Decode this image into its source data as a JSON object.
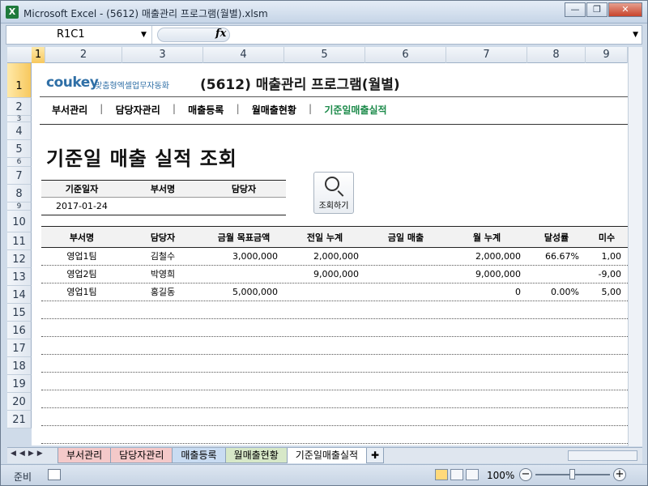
{
  "window": {
    "title": "Microsoft Excel - (5612) 매출관리 프로그램(월별).xlsm"
  },
  "formula_bar": {
    "name_box": "R1C1",
    "fx": "fx",
    "value": ""
  },
  "columns": [
    "1",
    "2",
    "3",
    "4",
    "5",
    "6",
    "7",
    "8",
    "9"
  ],
  "rows": [
    "1",
    "2",
    "3",
    "4",
    "5",
    "6",
    "7",
    "8",
    "9",
    "10",
    "11",
    "12",
    "13",
    "14",
    "15",
    "16",
    "17",
    "18",
    "19",
    "20",
    "21"
  ],
  "sheet": {
    "logo": "coukey",
    "logo_sub": "맞춤형엑셀업무자동화",
    "title": "(5612) 매출관리 프로그램(월별)",
    "nav": [
      "부서관리",
      "담당자관리",
      "매출등록",
      "월매출현황",
      "기준일매출실적"
    ],
    "page_title": "기준일 매출 실적 조회",
    "query": {
      "headers": [
        "기준일자",
        "부서명",
        "담당자"
      ],
      "values": [
        "2017-01-24",
        "",
        ""
      ]
    },
    "search_button": "조회하기",
    "table": {
      "headers": [
        "부서명",
        "담당자",
        "금월 목표금액",
        "전일 누계",
        "금일 매출",
        "월 누계",
        "달성률",
        "미수"
      ],
      "rows": [
        [
          "영업1팀",
          "김철수",
          "3,000,000",
          "2,000,000",
          "",
          "2,000,000",
          "66.67%",
          "1,00"
        ],
        [
          "영업2팀",
          "박영희",
          "",
          "9,000,000",
          "",
          "9,000,000",
          "",
          "-9,00"
        ],
        [
          "영업1팀",
          "홍길동",
          "5,000,000",
          "",
          "",
          "0",
          "0.00%",
          "5,00"
        ]
      ]
    }
  },
  "tabs": [
    "부서관리",
    "담당자관리",
    "매출등록",
    "월매출현황",
    "기준일매출실적"
  ],
  "status": {
    "ready": "준비",
    "zoom": "100%"
  }
}
